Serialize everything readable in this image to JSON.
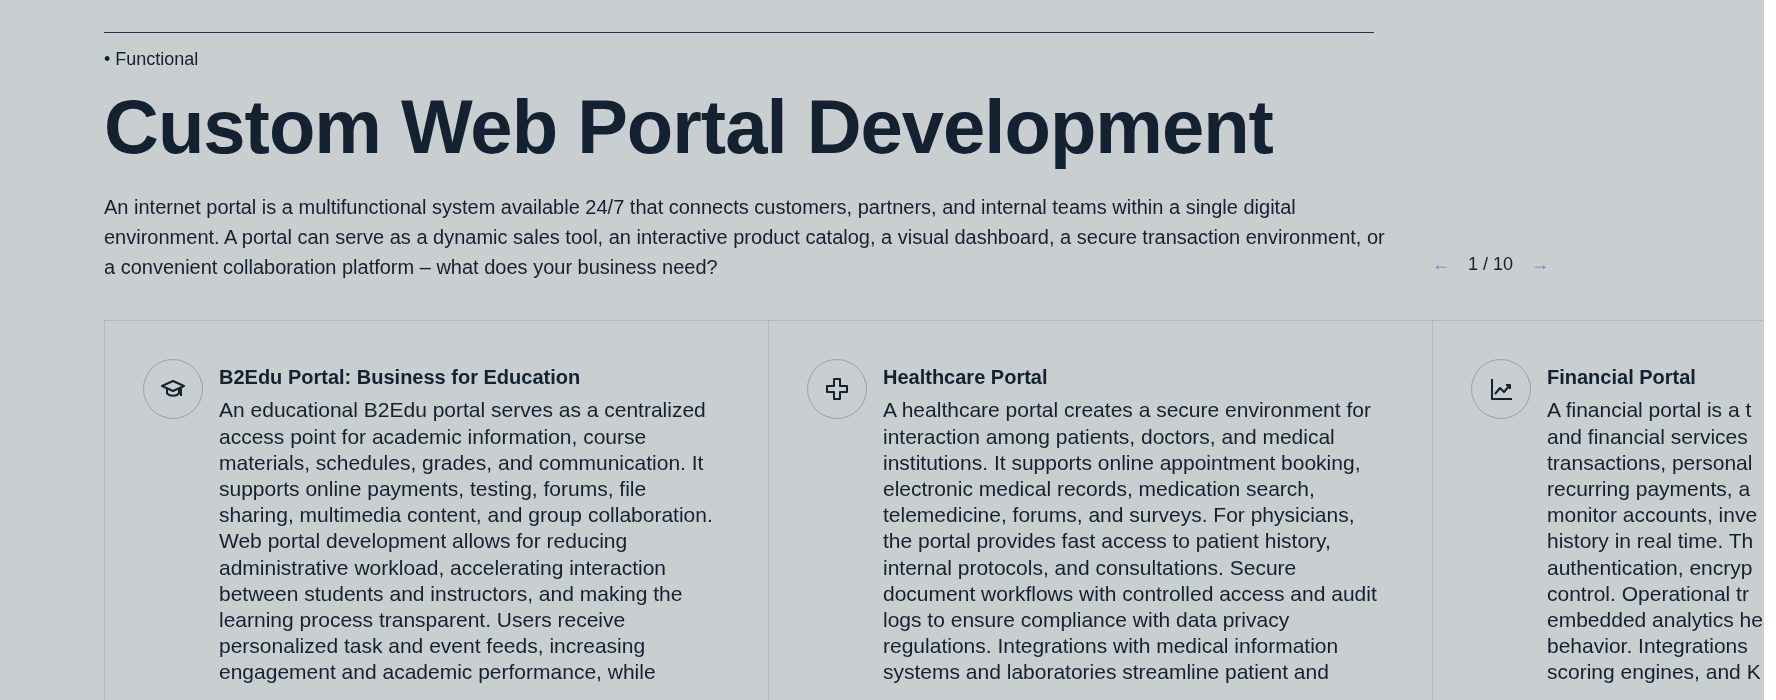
{
  "section_label": "• Functional",
  "heading": "Custom Web Portal Development",
  "intro": "An internet portal is a multifunctional system available 24/7 that connects customers, partners, and internal teams within a single digital environment. A portal can serve as a dynamic sales tool, an interactive product catalog, a visual dashboard, a secure transaction environment, or a convenient collaboration platform – what does your business need?",
  "pager": {
    "prev": "←",
    "counter": "1 / 10",
    "next": "→"
  },
  "cards": [
    {
      "kind": "graduation-cap",
      "title": "B2Edu Portal: Business for Education",
      "lines": [
        "An educational B2Edu portal serves as a centralized",
        "access point for academic information, course",
        "materials, schedules, grades, and communication. It",
        "supports online payments, testing, forums, file",
        "sharing, multimedia content, and group collaboration.",
        "Web portal development allows for reducing",
        "administrative workload, accelerating interaction",
        "between students and instructors, and making the",
        "learning process transparent. Users receive",
        "personalized task and event feeds, increasing",
        "engagement and academic performance, while"
      ]
    },
    {
      "kind": "medical-cross",
      "title": "Healthcare Portal",
      "lines": [
        "A healthcare portal creates a secure environment for",
        "interaction among patients, doctors, and medical",
        "institutions. It supports online appointment booking,",
        "electronic medical records, medication search,",
        "telemedicine, forums, and surveys. For physicians,",
        "the portal provides fast access to patient history,",
        "internal protocols, and consultations. Secure",
        "document workflows with controlled access and audit",
        "logs to ensure compliance with data privacy",
        "regulations. Integrations with medical information",
        "systems and laboratories streamline patient and"
      ]
    },
    {
      "kind": "line-chart",
      "title": "Financial Portal",
      "lines": [
        "A financial portal is a t",
        "and financial services",
        "transactions, personal",
        "recurring payments, a",
        "monitor accounts, inve",
        "history in real time. Th",
        "authentication, encryp",
        "control. Operational tr",
        "embedded analytics he",
        "behavior. Integrations",
        "scoring engines, and K"
      ]
    }
  ]
}
